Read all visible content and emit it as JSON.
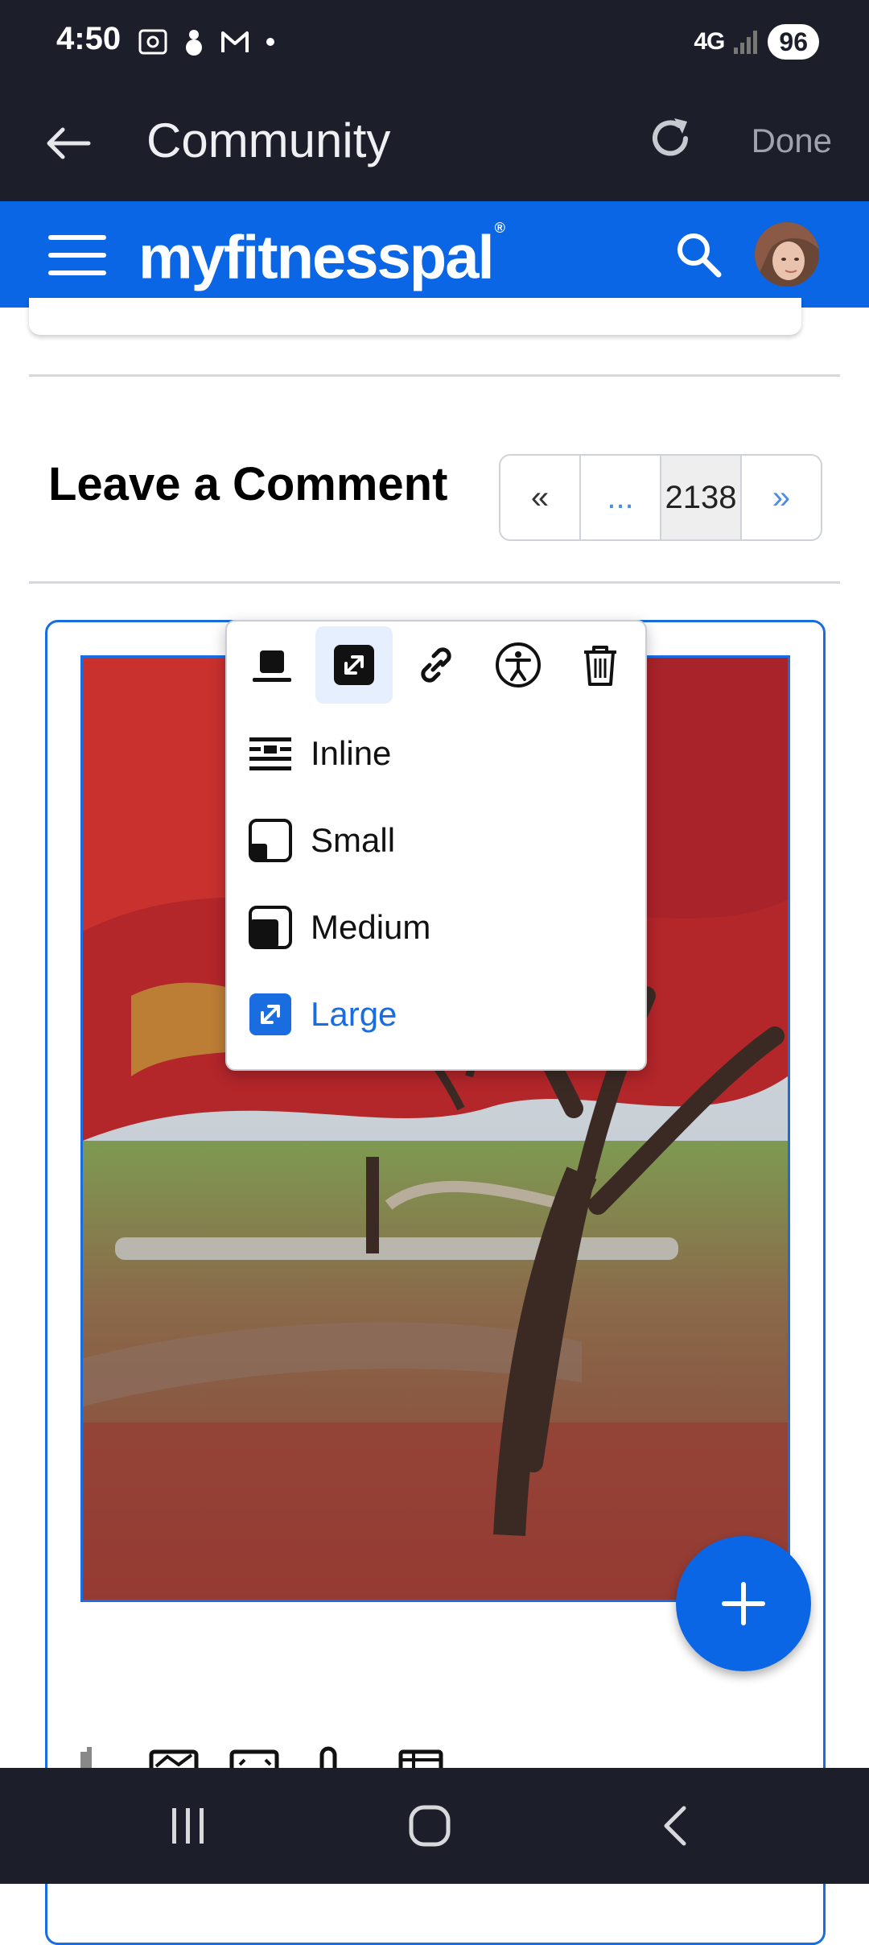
{
  "status_bar": {
    "time": "4:50",
    "network": "4G",
    "battery": "96"
  },
  "app_bar": {
    "title": "Community",
    "done_label": "Done"
  },
  "brand_bar": {
    "logo_text": "myfitnesspal",
    "registered_mark": "®"
  },
  "comment_section": {
    "heading": "Leave a Comment",
    "pagination": {
      "first": "«",
      "ellipsis": "...",
      "current_page": "2138",
      "next": "»"
    }
  },
  "image_popover": {
    "toolbar": [
      {
        "icon": "align-block-icon",
        "active": false
      },
      {
        "icon": "resize-icon",
        "active": true
      },
      {
        "icon": "link-icon",
        "active": false
      },
      {
        "icon": "accessibility-icon",
        "active": false
      },
      {
        "icon": "trash-icon",
        "active": false
      }
    ],
    "size_options": [
      {
        "label": "Inline",
        "icon": "inline-icon",
        "selected": false
      },
      {
        "label": "Small",
        "icon": "small-size-icon",
        "selected": false
      },
      {
        "label": "Medium",
        "icon": "medium-size-icon",
        "selected": false
      },
      {
        "label": "Large",
        "icon": "large-size-icon",
        "selected": true
      }
    ]
  },
  "colors": {
    "brand_blue": "#0a66e4",
    "system_bar": "#1c1e2a",
    "selection_blue": "#1a6de0"
  }
}
